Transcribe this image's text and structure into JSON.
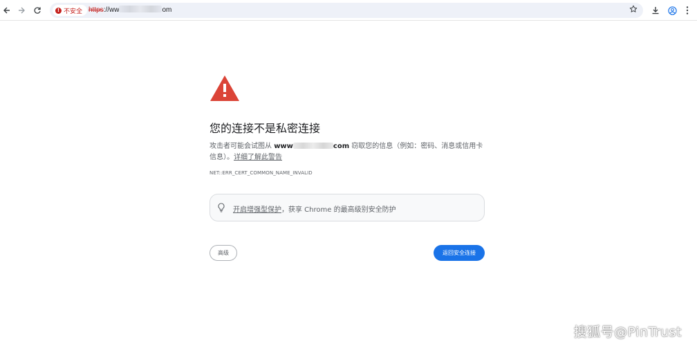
{
  "browser": {
    "security_chip_label": "不安全",
    "url": {
      "scheme": "https",
      "rest_before_blur": "://ww",
      "rest_after_blur": "om"
    },
    "icons": {
      "back": "arrow-left-icon",
      "forward": "arrow-right-icon",
      "reload": "reload-icon",
      "not_secure": "warning-circle-icon",
      "bookmark": "star-icon",
      "download": "download-icon",
      "profile": "profile-icon",
      "menu": "kebab-menu-icon"
    }
  },
  "page": {
    "heading": "您的连接不是私密连接",
    "paragraph": {
      "lead": "攻击者可能会试图从 ",
      "domain_start": "www",
      "domain_end": "com",
      "tail": " 窃取您的信息（例如：密码、消息或信用卡信息）。",
      "link": "详细了解此警告"
    },
    "error_code": "NET::ERR_CERT_COMMON_NAME_INVALID",
    "promo": {
      "link": "开启增强型保护",
      "text": "，获享 Chrome 的最高级别安全防护"
    },
    "buttons": {
      "advanced": "高级",
      "back_to_safety": "返回安全连接"
    }
  },
  "watermark": "搜狐号@PinTrust",
  "colors": {
    "warning_red": "#db4437",
    "primary_blue": "#1a73e8",
    "not_secure_red": "#c5221f"
  }
}
